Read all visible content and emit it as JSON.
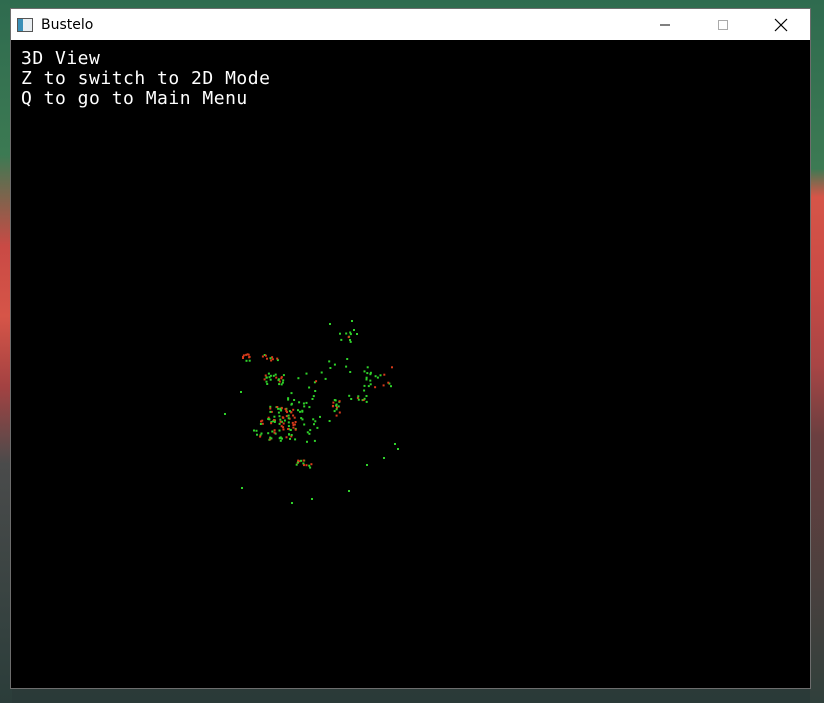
{
  "window": {
    "title": "Bustelo",
    "icon": "app-window-icon"
  },
  "controls": {
    "minimize_icon": "minimize-icon",
    "maximize_icon": "maximize-icon",
    "close_icon": "close-icon"
  },
  "hud": {
    "line1": "3D View",
    "line2": "Z to switch to 2D Mode",
    "line3": "Q to go to Main Menu"
  },
  "colors": {
    "point_green": "#2fd12a",
    "point_red": "#d83a1a",
    "background": "#000000",
    "hud_text": "#ffffff"
  }
}
